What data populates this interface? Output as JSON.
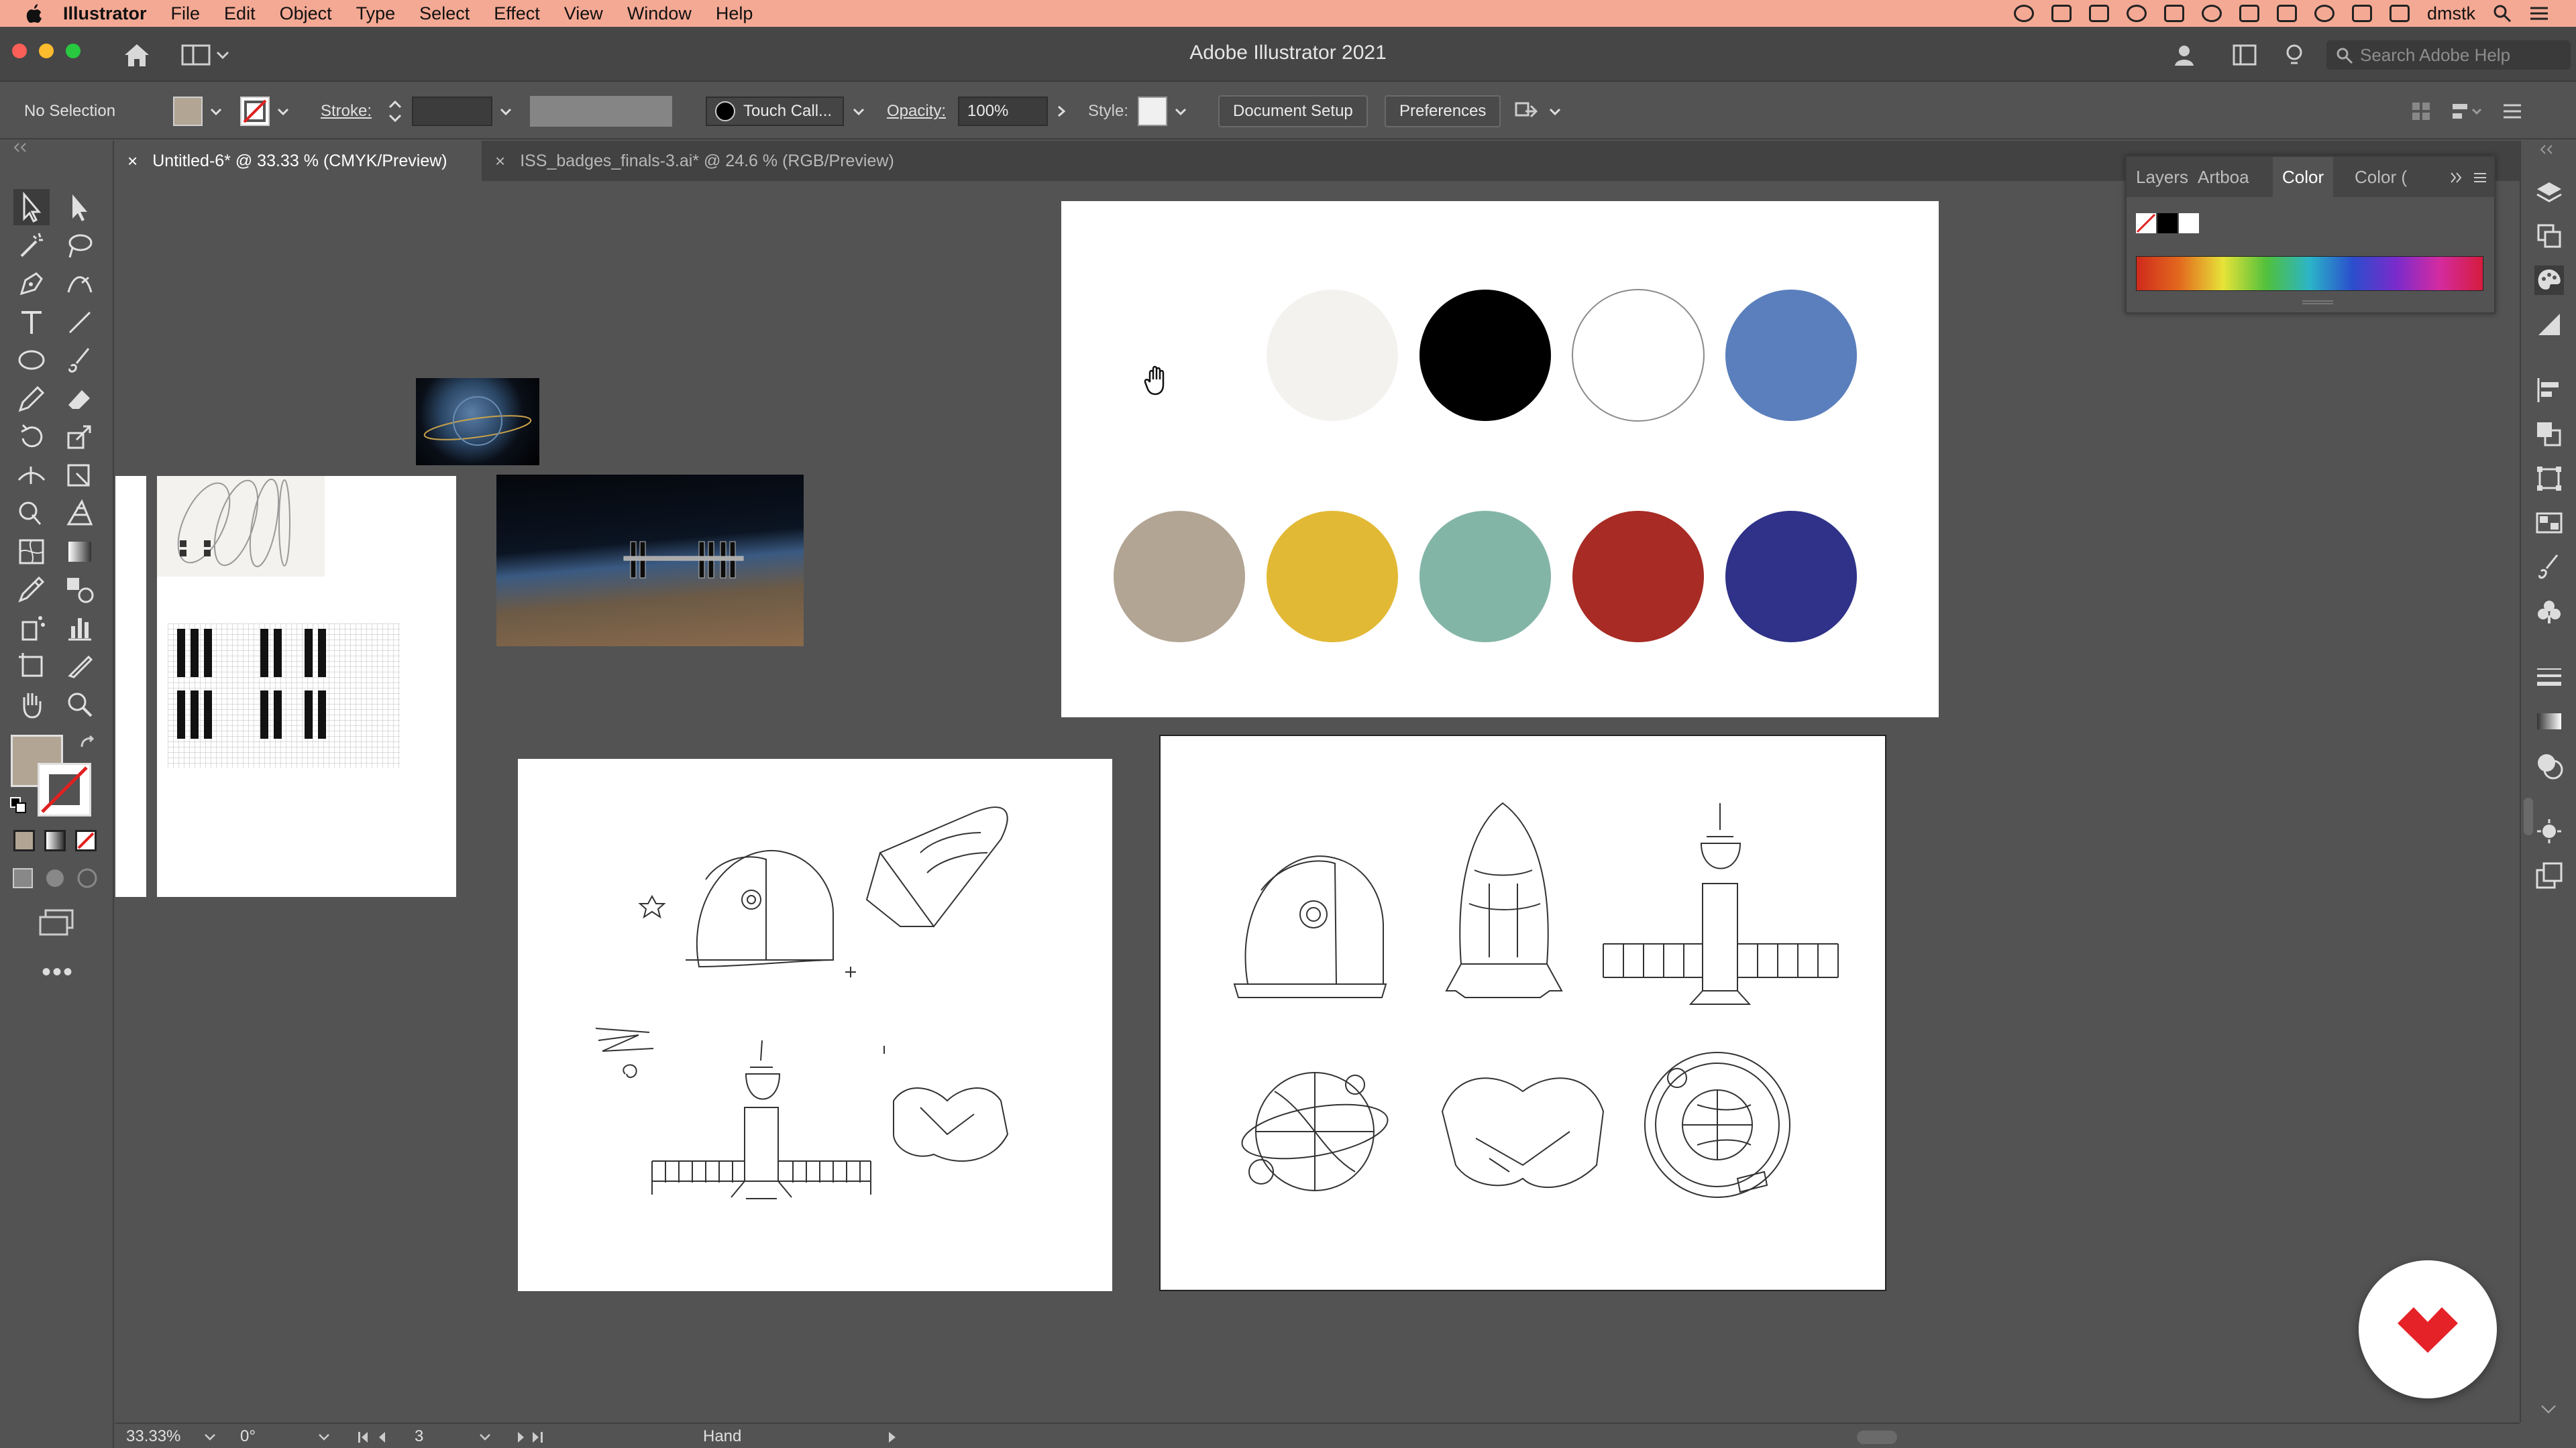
{
  "menubar": {
    "app_name": "Illustrator",
    "items": [
      "File",
      "Edit",
      "Object",
      "Type",
      "Select",
      "Effect",
      "View",
      "Window",
      "Help"
    ],
    "user": "dmstk"
  },
  "titlebar": {
    "title": "Adobe Illustrator 2021",
    "search_placeholder": "Search Adobe Help"
  },
  "controlbar": {
    "selection": "No Selection",
    "stroke_label": "Stroke:",
    "brush_name": "Touch Call...",
    "opacity_label": "Opacity:",
    "opacity_value": "100%",
    "style_label": "Style:",
    "document_setup": "Document Setup",
    "preferences": "Preferences",
    "fill_color": "#b2a594"
  },
  "tabs": [
    {
      "label": "Untitled-6* @ 33.33 % (CMYK/Preview)",
      "close": "×"
    },
    {
      "label": "ISS_badges_finals-3.ai* @ 24.6 % (RGB/Preview)",
      "close": "×"
    }
  ],
  "color_panel": {
    "tabs": [
      "Layers",
      "Artboa",
      "Color",
      "Color ("
    ],
    "active_tab": "Color"
  },
  "palette": {
    "row1": [
      "#f3f2ee",
      "#000000",
      "#ffffff",
      "#5b7fbc"
    ],
    "row2": [
      "#b2a594",
      "#e2b935",
      "#83b5a7",
      "#a82b25",
      "#2f3288"
    ]
  },
  "statusbar": {
    "zoom": "33.33%",
    "rotation": "0°",
    "artboard_num": "3",
    "tool_name": "Hand"
  },
  "icons": {
    "hand_cursor": "hand-cursor-icon",
    "badge": "domestika-logo"
  }
}
